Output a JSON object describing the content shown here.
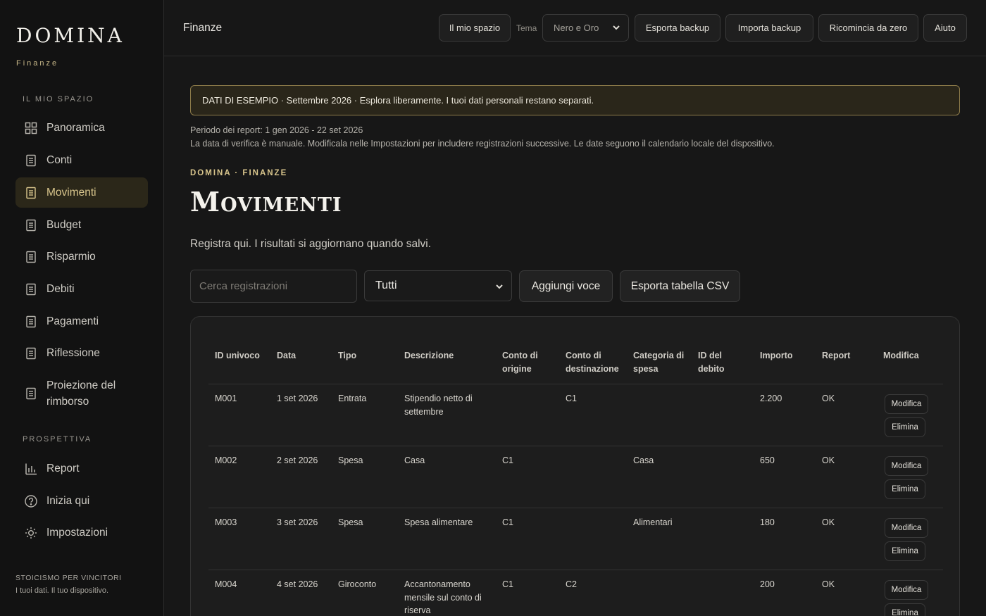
{
  "app": {
    "brand": "DOMINA",
    "brand_sub": "Finanze"
  },
  "sidebar": {
    "section1": "IL MIO SPAZIO",
    "items": [
      {
        "label": "Panoramica",
        "icon": "grid-icon"
      },
      {
        "label": "Conti",
        "icon": "document-icon"
      },
      {
        "label": "Movimenti",
        "icon": "document-icon",
        "active": true
      },
      {
        "label": "Budget",
        "icon": "document-icon"
      },
      {
        "label": "Risparmio",
        "icon": "document-icon"
      },
      {
        "label": "Debiti",
        "icon": "document-icon"
      },
      {
        "label": "Pagamenti",
        "icon": "document-icon"
      },
      {
        "label": "Riflessione",
        "icon": "document-icon"
      },
      {
        "label": "Proiezione del rimborso",
        "icon": "document-icon"
      }
    ],
    "section2": "PROSPETTIVA",
    "items2": [
      {
        "label": "Report",
        "icon": "bar-chart-icon"
      },
      {
        "label": "Inizia qui",
        "icon": "help-icon"
      },
      {
        "label": "Impostazioni",
        "icon": "sun-icon"
      }
    ],
    "footer_title": "STOICISMO PER VINCITORI",
    "footer_text": "I tuoi dati. Il tuo dispositivo."
  },
  "header": {
    "title": "Finanze",
    "my_space": "Il mio spazio",
    "theme_label": "Tema",
    "theme_value": "Nero e Oro",
    "export_backup": "Esporta backup",
    "import_backup": "Importa backup",
    "restart": "Ricomincia da zero",
    "help": "Aiuto"
  },
  "main": {
    "banner": "DATI DI ESEMPIO · Settembre 2026 · Esplora liberamente. I tuoi dati personali restano separati.",
    "period": "Periodo dei report: 1 gen 2026 - 22 set 2026",
    "note": "La data di verifica è manuale. Modificala nelle Impostazioni per includere registrazioni successive. Le date seguono il calendario locale del dispositivo.",
    "kicker": "DOMINA · FINANZE",
    "title": "Movimenti",
    "lead": "Registra qui. I risultati si aggiornano quando salvi.",
    "search_placeholder": "Cerca registrazioni",
    "filter_value": "Tutti",
    "add_label": "Aggiungi voce",
    "export_csv": "Esporta tabella CSV"
  },
  "table": {
    "columns": [
      "ID univoco",
      "Data",
      "Tipo",
      "Descrizione",
      "Conto di origine",
      "Conto di destinazione",
      "Categoria di spesa",
      "ID del debito",
      "Importo",
      "Report",
      "Modifica"
    ],
    "edit_label": "Modifica",
    "delete_label": "Elimina",
    "rows": [
      {
        "id": "M001",
        "date": "1 set 2026",
        "type": "Entrata",
        "desc": "Stipendio netto di settembre",
        "from": "",
        "to": "C1",
        "cat": "",
        "debt": "",
        "amount": "2.200",
        "report": "OK"
      },
      {
        "id": "M002",
        "date": "2 set 2026",
        "type": "Spesa",
        "desc": "Casa",
        "from": "C1",
        "to": "",
        "cat": "Casa",
        "debt": "",
        "amount": "650",
        "report": "OK"
      },
      {
        "id": "M003",
        "date": "3 set 2026",
        "type": "Spesa",
        "desc": "Spesa alimentare",
        "from": "C1",
        "to": "",
        "cat": "Alimentari",
        "debt": "",
        "amount": "180",
        "report": "OK"
      },
      {
        "id": "M004",
        "date": "4 set 2026",
        "type": "Giroconto",
        "desc": "Accantonamento mensile sul conto di riserva",
        "from": "C1",
        "to": "C2",
        "cat": "",
        "debt": "",
        "amount": "200",
        "report": "OK"
      }
    ]
  }
}
